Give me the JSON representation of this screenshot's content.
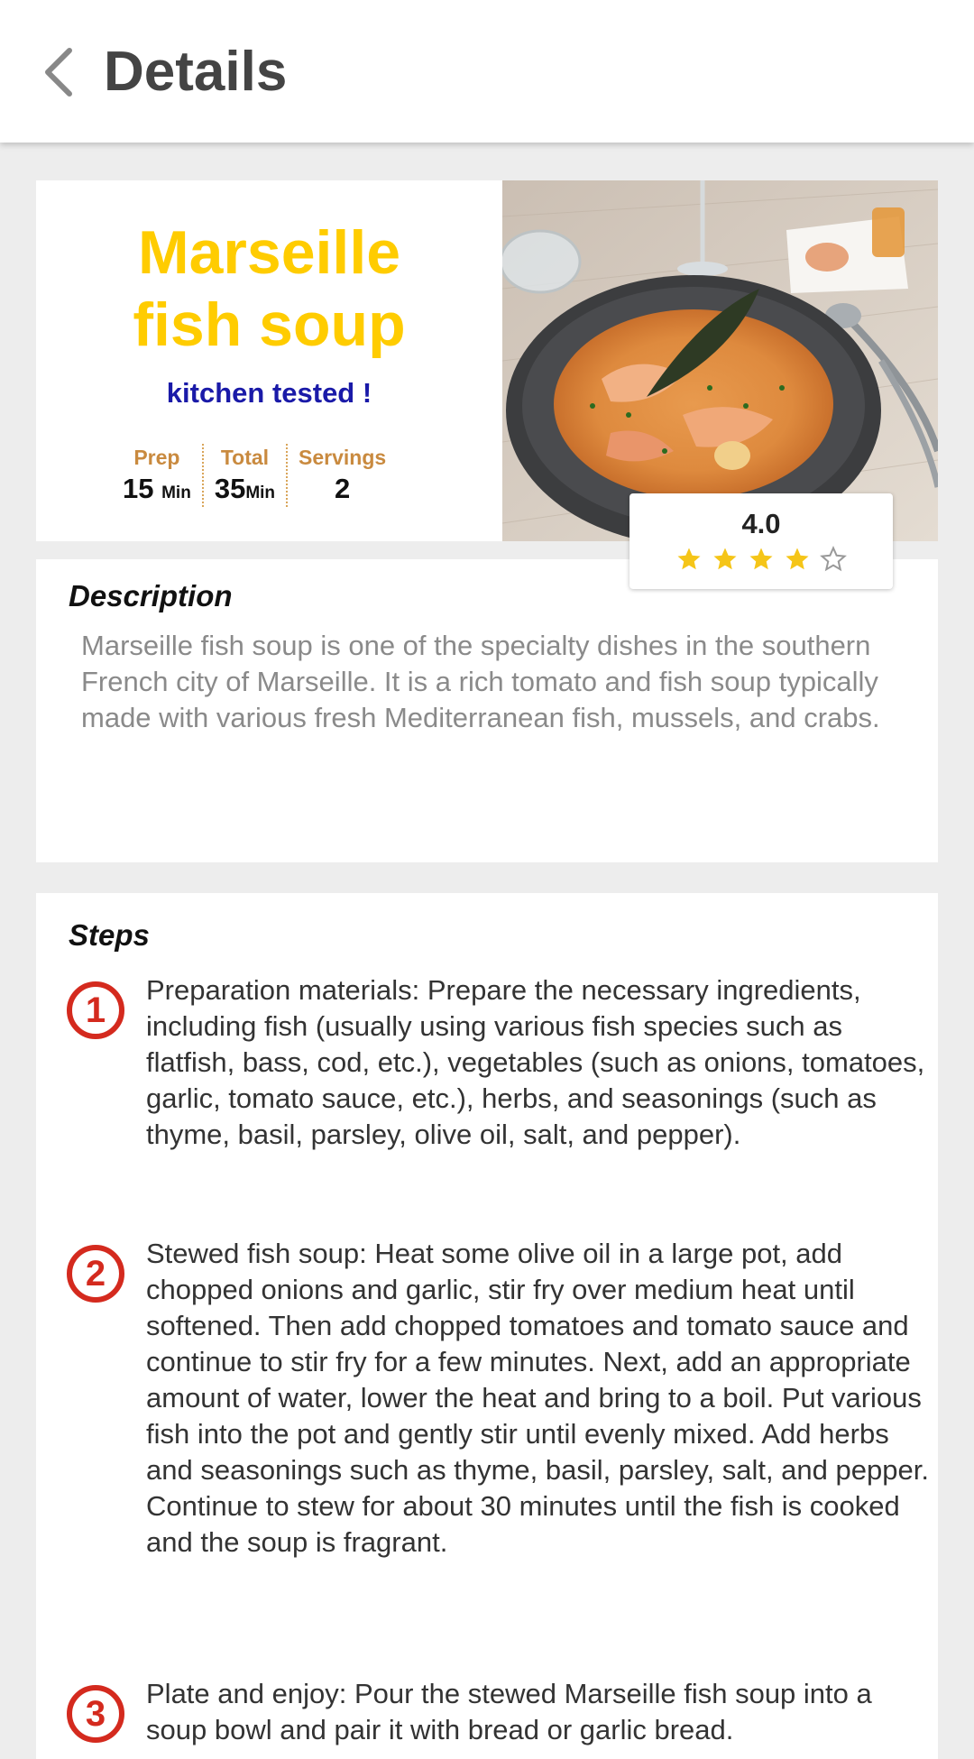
{
  "header": {
    "title": "Details",
    "back_icon": "chevron-left-icon"
  },
  "recipe": {
    "title_line1": "Marseille",
    "title_line2": "fish soup",
    "badge": "kitchen tested !",
    "stats": {
      "prep_label": "Prep",
      "prep_value": "15",
      "prep_unit": "Min",
      "total_label": "Total",
      "total_value": "35",
      "total_unit": "Min",
      "servings_label": "Servings",
      "servings_value": "2"
    },
    "rating": {
      "value_text": "4.0",
      "stars_filled": 4,
      "stars_total": 5
    }
  },
  "description": {
    "heading": "Description",
    "text": "Marseille fish soup is one of the specialty dishes in the southern French city of Marseille. It is a rich tomato and fish soup typically made with various fresh Mediterranean fish, mussels, and crabs."
  },
  "steps": {
    "heading": "Steps",
    "items": [
      {
        "number": "1",
        "text": "Preparation materials: Prepare the necessary ingredients, including fish (usually using various fish species such as flatfish, bass, cod, etc.), vegetables (such as onions, tomatoes, garlic, tomato sauce, etc.), herbs, and seasonings (such as thyme, basil, parsley, olive oil, salt, and pepper)."
      },
      {
        "number": "2",
        "text": "Stewed fish soup: Heat some olive oil in a large pot, add chopped onions and garlic, stir fry over medium heat until softened. Then add chopped tomatoes and tomato sauce and continue to stir fry for a few minutes. Next, add an appropriate amount of water, lower the heat and bring to a boil. Put various fish into the pot and gently stir until evenly mixed. Add herbs and seasonings such as thyme, basil, parsley, salt, and pepper. Continue to stew for about 30 minutes until the fish is cooked and the soup is fragrant."
      },
      {
        "number": "3",
        "text": "Plate and enjoy: Pour the stewed Marseille fish soup into a soup bowl and pair it with bread or garlic bread."
      }
    ]
  },
  "colors": {
    "title_yellow": "#ffcc00",
    "badge_blue": "#1a1aa8",
    "stat_label_orange": "#c98a3f",
    "step_red": "#d42a1e",
    "star_gold": "#f5c518"
  }
}
